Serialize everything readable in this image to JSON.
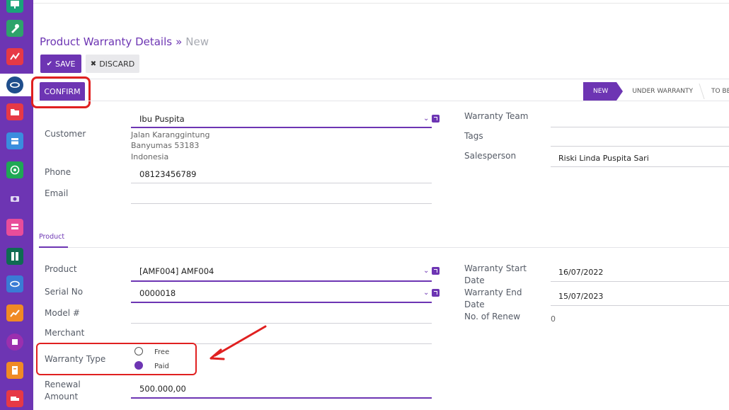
{
  "breadcrumb": {
    "main": "Product Warranty Details",
    "separator": "»",
    "current": "New"
  },
  "toolbar": {
    "save_label": "SAVE",
    "discard_label": "DISCARD",
    "confirm_label": "CONFIRM"
  },
  "status": {
    "stages": [
      "NEW",
      "UNDER WARRANTY",
      "TO BE INVO"
    ],
    "active": "NEW"
  },
  "customer": {
    "label": "Customer",
    "name": "Ibu Puspita",
    "address_line1": "Jalan Karanggintung",
    "address_line2": "Banyumas 53183",
    "address_line3": "Indonesia"
  },
  "phone": {
    "label": "Phone",
    "value": "08123456789"
  },
  "email": {
    "label": "Email",
    "value": ""
  },
  "warranty_team": {
    "label": "Warranty Team",
    "value": ""
  },
  "tags": {
    "label": "Tags",
    "value": ""
  },
  "salesperson": {
    "label": "Salesperson",
    "value": "Riski Linda Puspita Sari"
  },
  "tabs": {
    "product": "Product"
  },
  "product": {
    "label": "Product",
    "value": "[AMF004] AMF004"
  },
  "serial": {
    "label": "Serial No",
    "value": "0000018"
  },
  "model": {
    "label": "Model #",
    "value": ""
  },
  "merchant": {
    "label": "Merchant",
    "value": ""
  },
  "warranty_type": {
    "label": "Warranty Type",
    "options": [
      "Free",
      "Paid"
    ],
    "selected": "Paid"
  },
  "renewal": {
    "label_line1": "Renewal",
    "label_line2": "Amount",
    "value": "500.000,00"
  },
  "warranty_start": {
    "label_line1": "Warranty Start",
    "label_line2": "Date",
    "value": "16/07/2022"
  },
  "warranty_end": {
    "label_line1": "Warranty End",
    "label_line2": "Date",
    "value": "15/07/2023"
  },
  "renew_count": {
    "label": "No. of Renew",
    "value": "0"
  },
  "colors": {
    "brand": "#6d35b3",
    "highlight": "#e02020"
  },
  "sidebar": {
    "apps": [
      "presentation-icon",
      "tools-icon",
      "activity-icon",
      "warranty-app-icon",
      "folder-icon",
      "box-icon",
      "whatsapp-icon",
      "camera-icon",
      "forms-icon",
      "library-icon",
      "handshake-icon",
      "chart-icon",
      "sticky-note-icon",
      "invoice-icon",
      "delivery-icon"
    ]
  }
}
